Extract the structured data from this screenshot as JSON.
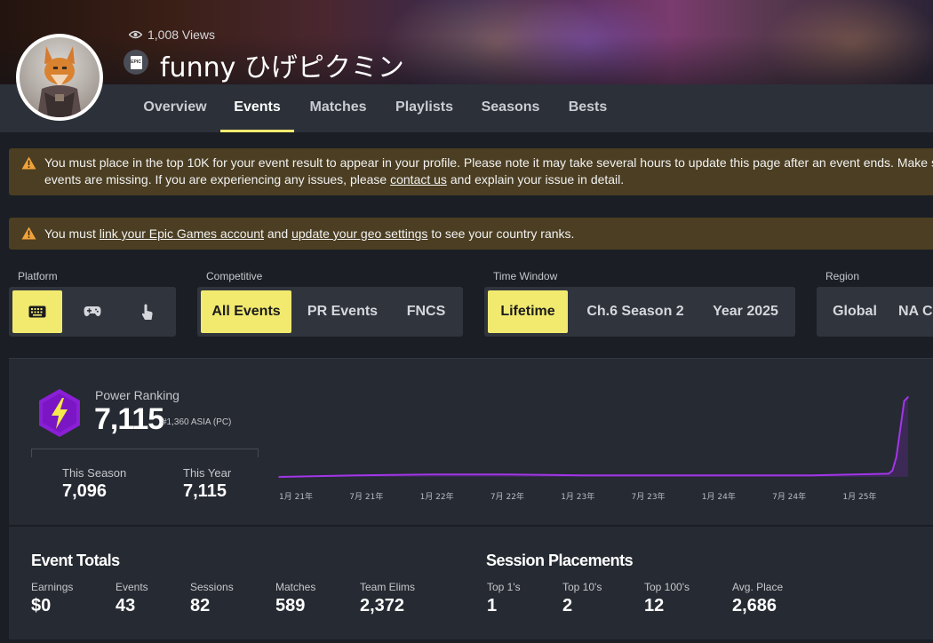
{
  "profile": {
    "views": "1,008 Views",
    "platform_badge": "EPIC",
    "username": "funny ひげピクミン"
  },
  "tabs": [
    "Overview",
    "Events",
    "Matches",
    "Playlists",
    "Seasons",
    "Bests"
  ],
  "active_tab": "Events",
  "alerts": {
    "alert1": {
      "line1": "You must place in the top 10K for your event result to appear in your profile. Please note it may take several hours to update this page after an event ends. Make su",
      "line2_pre": "events are missing. If you are experiencing any issues, please ",
      "line2_link": "contact us",
      "line2_post": " and explain your issue in detail."
    },
    "alert2": {
      "pre": "You must ",
      "link1": "link your Epic Games account",
      "mid": " and ",
      "link2": "update your geo settings",
      "post": " to see your country ranks."
    }
  },
  "filters": {
    "platform": {
      "label": "Platform",
      "options": [
        "keyboard-icon",
        "gamepad-icon",
        "touch-icon"
      ],
      "selected": "keyboard-icon"
    },
    "competitive": {
      "label": "Competitive",
      "options": [
        "All Events",
        "PR Events",
        "FNCS"
      ],
      "selected": "All Events"
    },
    "time_window": {
      "label": "Time Window",
      "options": [
        "Lifetime",
        "Ch.6 Season 2",
        "Year 2025"
      ],
      "selected": "Lifetime"
    },
    "region": {
      "label": "Region",
      "options": [
        "Global",
        "NA C"
      ],
      "selected": "Global"
    }
  },
  "power_ranking": {
    "label": "Power Ranking",
    "value": "7,115",
    "rank": "#1,360 ASIA (PC)",
    "this_season_label": "This Season",
    "this_season_value": "7,096",
    "this_year_label": "This Year",
    "this_year_value": "7,115"
  },
  "chart_data": {
    "type": "line",
    "x": [
      "1月 21年",
      "7月 21年",
      "1月 22年",
      "7月 22年",
      "1月 23年",
      "7月 23年",
      "1月 24年",
      "7月 24年",
      "1月 25年"
    ],
    "tick_labels": [
      "1月 21年",
      "7月 21年",
      "1月 22年",
      "7月 22年",
      "1月 23年",
      "7月 23年",
      "1月 24年",
      "7月 24年",
      "1月 25年"
    ],
    "series": [
      {
        "values": [
          0,
          2,
          3,
          3,
          2,
          2,
          2,
          2,
          4,
          8,
          25,
          60,
          95,
          100
        ]
      }
    ],
    "grid": false,
    "color": "#a236e8"
  },
  "event_totals": {
    "title": "Event Totals",
    "stats": [
      {
        "label": "Earnings",
        "value": "$0"
      },
      {
        "label": "Events",
        "value": "43"
      },
      {
        "label": "Sessions",
        "value": "82"
      },
      {
        "label": "Matches",
        "value": "589"
      },
      {
        "label": "Team Elims",
        "value": "2,372"
      }
    ]
  },
  "session_placements": {
    "title": "Session Placements",
    "stats": [
      {
        "label": "Top 1's",
        "value": "1"
      },
      {
        "label": "Top 10's",
        "value": "2"
      },
      {
        "label": "Top 100's",
        "value": "12"
      },
      {
        "label": "Avg. Place",
        "value": "2,686"
      }
    ]
  },
  "colors": {
    "accent": "#f1ea6f",
    "power": "#8a1fd6",
    "alert_bg": "#4b3e22",
    "warn_icon": "#f0a23a"
  }
}
